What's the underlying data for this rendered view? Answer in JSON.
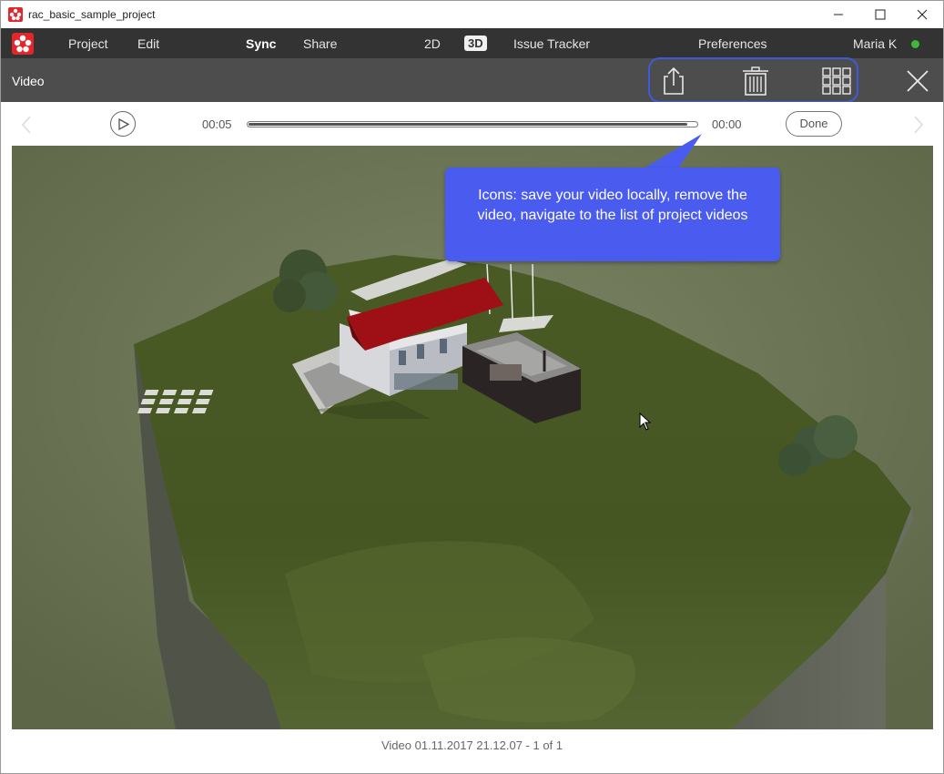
{
  "window": {
    "title": "rac_basic_sample_project",
    "icons": [
      "app-logo-icon",
      "minimize-icon",
      "maximize-icon",
      "close-icon"
    ]
  },
  "menu": {
    "project": "Project",
    "edit": "Edit",
    "sync": "Sync",
    "share": "Share",
    "view_2d": "2D",
    "view_3d": "3D",
    "issue_tracker": "Issue Tracker",
    "preferences": "Preferences",
    "user": "Maria K",
    "status_color": "#3db838"
  },
  "video_header": {
    "title": "Video",
    "icons": [
      "share-export-icon",
      "trash-icon",
      "grid-icon",
      "close-icon"
    ],
    "highlight_color": "#3d5bd9"
  },
  "playback": {
    "elapsed": "00:05",
    "remaining": "00:00",
    "progress_fraction": 0.98,
    "done_label": "Done",
    "icons": [
      "chevron-left-icon",
      "play-icon",
      "chevron-right-icon"
    ]
  },
  "callout": {
    "text": "Icons: save your video locally, remove the video, navigate to the list of project videos",
    "color": "#4a5cf0"
  },
  "footer": {
    "caption": "Video 01.11.2017 21.12.07 - 1 of 1"
  }
}
